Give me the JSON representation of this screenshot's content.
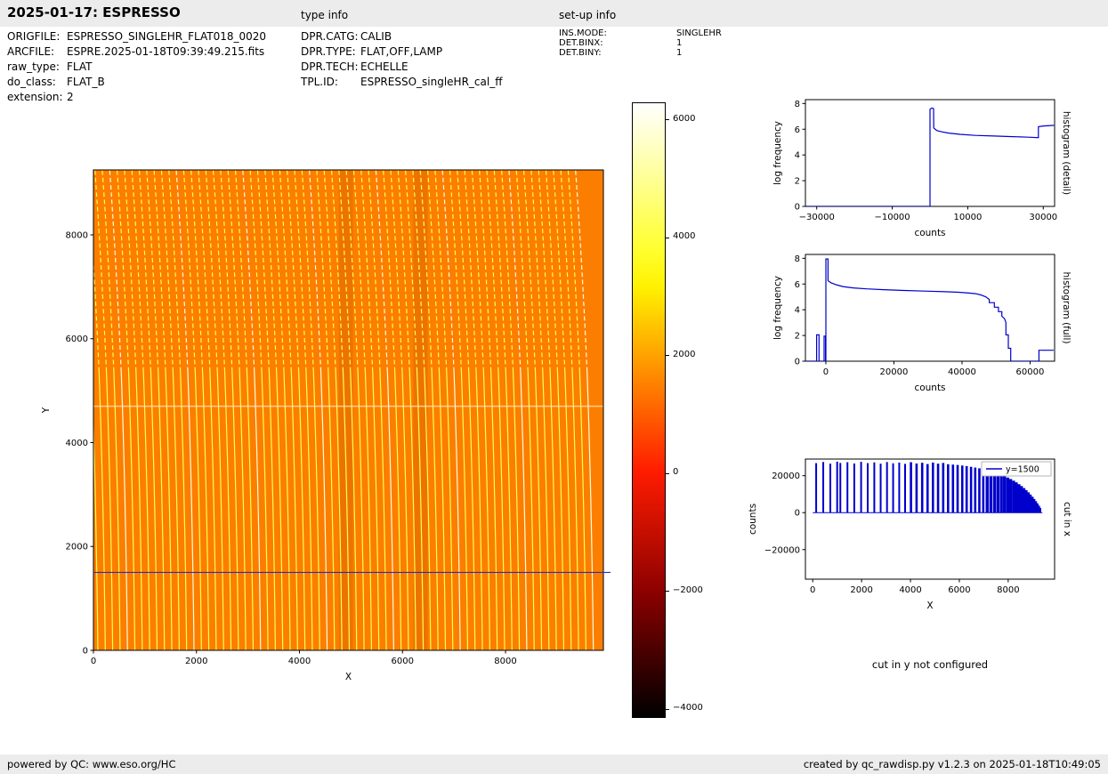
{
  "header": {
    "title": "2025-01-17: ESPRESSO",
    "type_info_label": "type info",
    "setup_info_label": "set-up info"
  },
  "file_info": {
    "rows": [
      {
        "label": "ORIGFILE:",
        "value": "ESPRESSO_SINGLEHR_FLAT018_0020"
      },
      {
        "label": "ARCFILE:",
        "value": "ESPRE.2025-01-18T09:39:49.215.fits"
      },
      {
        "label": "raw_type:",
        "value": "FLAT"
      },
      {
        "label": "do_class:",
        "value": "FLAT_B"
      },
      {
        "label": "extension:",
        "value": "2"
      }
    ]
  },
  "type_info": {
    "rows": [
      {
        "label": "DPR.CATG:",
        "value": "CALIB"
      },
      {
        "label": "DPR.TYPE:",
        "value": "FLAT,OFF,LAMP"
      },
      {
        "label": "DPR.TECH:",
        "value": "ECHELLE"
      },
      {
        "label": "TPL.ID:",
        "value": "ESPRESSO_singleHR_cal_ff"
      }
    ]
  },
  "setup_info": {
    "rows": [
      {
        "label": "INS.MODE:",
        "value": "SINGLEHR"
      },
      {
        "label": "DET.BINX:",
        "value": "1"
      },
      {
        "label": "DET.BINY:",
        "value": "1"
      }
    ]
  },
  "notes": {
    "cut_in_y": "cut in y not configured"
  },
  "footer": {
    "left": "powered by QC: www.eso.org/HC",
    "right": "created by qc_rawdisp.py v1.2.3 on 2025-01-18T10:49:05"
  },
  "chart_data": [
    {
      "id": "raw_image",
      "type": "heatmap",
      "title": "",
      "xlabel": "X",
      "ylabel": "Y",
      "xlim": [
        0,
        9900
      ],
      "ylim": [
        0,
        9250
      ],
      "xticks": [
        0,
        2000,
        4000,
        6000,
        8000
      ],
      "yticks": [
        0,
        2000,
        4000,
        6000,
        8000
      ],
      "background_color": "#fc7e00",
      "order_colors": [
        "#ffff4d",
        "#ffffd8"
      ],
      "n_orders": 68,
      "dark_bands_x": [
        4900,
        6350
      ],
      "light_band_y": 4700,
      "cut_line": {
        "y": 1500,
        "color": "#2e2eb8"
      },
      "colorbar": {
        "vmin": -4120,
        "vmax": 6300,
        "ticks": [
          6000,
          4000,
          2000,
          0,
          -2000,
          -4000
        ],
        "cmap": "hot",
        "gradient_stops": [
          {
            "pos": 0.0,
            "color": "#000000"
          },
          {
            "pos": 0.2,
            "color": "#8a0000"
          },
          {
            "pos": 0.4,
            "color": "#ff1c00"
          },
          {
            "pos": 0.5,
            "color": "#ff6300"
          },
          {
            "pos": 0.6,
            "color": "#ffaa00"
          },
          {
            "pos": 0.7,
            "color": "#fff100"
          },
          {
            "pos": 0.76,
            "color": "#ffff2e"
          },
          {
            "pos": 0.87,
            "color": "#ffff8f"
          },
          {
            "pos": 1.0,
            "color": "#ffffff"
          }
        ]
      }
    },
    {
      "id": "histogram_detail",
      "type": "line",
      "side_label": "histogram (detail)",
      "xlabel": "counts",
      "ylabel": "log frequency",
      "xlim": [
        -33000,
        33000
      ],
      "ylim": [
        0,
        8.3
      ],
      "xticks": [
        -30000,
        -10000,
        10000,
        30000
      ],
      "yticks": [
        0,
        2,
        4,
        6,
        8
      ],
      "line_color": "#0000cc",
      "points": [
        [
          -32800,
          0
        ],
        [
          -700,
          0
        ],
        [
          0,
          0
        ],
        [
          0,
          7.55
        ],
        [
          500,
          7.65
        ],
        [
          950,
          7.6
        ],
        [
          1000,
          6.1
        ],
        [
          1800,
          5.9
        ],
        [
          3000,
          5.8
        ],
        [
          5000,
          5.7
        ],
        [
          8000,
          5.6
        ],
        [
          12000,
          5.52
        ],
        [
          17000,
          5.47
        ],
        [
          22000,
          5.42
        ],
        [
          26000,
          5.38
        ],
        [
          28700,
          5.35
        ],
        [
          28700,
          6.2
        ],
        [
          30000,
          6.25
        ],
        [
          32800,
          6.3
        ]
      ]
    },
    {
      "id": "histogram_full",
      "type": "line",
      "side_label": "histogram (full)",
      "xlabel": "counts",
      "ylabel": "log frequency",
      "xlim": [
        -6000,
        67200
      ],
      "ylim": [
        0,
        8.3
      ],
      "xticks": [
        0,
        20000,
        40000,
        60000
      ],
      "yticks": [
        0,
        2,
        4,
        6,
        8
      ],
      "line_color": "#0000cc",
      "points": [
        [
          -5800,
          0
        ],
        [
          -2700,
          0
        ],
        [
          -2700,
          2.05
        ],
        [
          -2000,
          2.05
        ],
        [
          -2000,
          0
        ],
        [
          -500,
          0
        ],
        [
          -500,
          1.95
        ],
        [
          -100,
          1.95
        ],
        [
          -100,
          0
        ],
        [
          0,
          0
        ],
        [
          0,
          7.95
        ],
        [
          650,
          7.95
        ],
        [
          650,
          6.25
        ],
        [
          1500,
          6.1
        ],
        [
          3000,
          5.95
        ],
        [
          5000,
          5.8
        ],
        [
          8000,
          5.7
        ],
        [
          12000,
          5.62
        ],
        [
          17000,
          5.56
        ],
        [
          23000,
          5.5
        ],
        [
          29000,
          5.45
        ],
        [
          35000,
          5.4
        ],
        [
          39000,
          5.36
        ],
        [
          42000,
          5.3
        ],
        [
          44000,
          5.25
        ],
        [
          45500,
          5.15
        ],
        [
          47000,
          5.0
        ],
        [
          48000,
          4.8
        ],
        [
          48000,
          4.55
        ],
        [
          49500,
          4.55
        ],
        [
          49500,
          4.2
        ],
        [
          50700,
          4.2
        ],
        [
          50700,
          3.85
        ],
        [
          51700,
          3.85
        ],
        [
          51700,
          3.5
        ],
        [
          52500,
          3.3
        ],
        [
          52900,
          3.0
        ],
        [
          52900,
          2.05
        ],
        [
          53600,
          2.05
        ],
        [
          53600,
          1.0
        ],
        [
          54300,
          1.0
        ],
        [
          54300,
          0
        ],
        [
          62600,
          0
        ],
        [
          62600,
          0.85
        ],
        [
          66900,
          0.85
        ]
      ]
    },
    {
      "id": "cut_in_x",
      "type": "bar",
      "side_label": "cut in x",
      "xlabel": "X",
      "ylabel": "counts",
      "legend": "y=1500",
      "xlim": [
        -300,
        9900
      ],
      "ylim": [
        -36000,
        29000
      ],
      "xticks": [
        0,
        2000,
        4000,
        6000,
        8000
      ],
      "yticks": [
        -20000,
        0,
        20000
      ],
      "line_color": "#0000cc",
      "baseline_x": [
        0,
        9400
      ],
      "bars": [
        [
          140,
          26800
        ],
        [
          430,
          27400
        ],
        [
          720,
          26500
        ],
        [
          1000,
          27600
        ],
        [
          1130,
          26900
        ],
        [
          1420,
          27300
        ],
        [
          1700,
          26600
        ],
        [
          1980,
          27500
        ],
        [
          2250,
          26800
        ],
        [
          2520,
          27200
        ],
        [
          2780,
          26500
        ],
        [
          3040,
          27400
        ],
        [
          3290,
          26700
        ],
        [
          3540,
          27100
        ],
        [
          3780,
          26400
        ],
        [
          4020,
          27300
        ],
        [
          4250,
          26600
        ],
        [
          4480,
          27000
        ],
        [
          4700,
          26300
        ],
        [
          4920,
          27100
        ],
        [
          5130,
          26500
        ],
        [
          5340,
          26900
        ],
        [
          5540,
          26200
        ],
        [
          5740,
          26000
        ],
        [
          5930,
          25800
        ],
        [
          6120,
          25500
        ],
        [
          6300,
          25200
        ],
        [
          6480,
          24800
        ],
        [
          6650,
          24400
        ],
        [
          6820,
          24000
        ],
        [
          6980,
          23500
        ],
        [
          7140,
          23000
        ],
        [
          7290,
          22400
        ],
        [
          7440,
          21800
        ],
        [
          7580,
          21200
        ],
        [
          7720,
          20500
        ],
        [
          7850,
          19800
        ],
        [
          7980,
          19000
        ],
        [
          8100,
          18200
        ],
        [
          8220,
          17300
        ],
        [
          8330,
          16400
        ],
        [
          8440,
          15400
        ],
        [
          8540,
          14400
        ],
        [
          8640,
          13300
        ],
        [
          8730,
          12200
        ],
        [
          8820,
          11000
        ],
        [
          8900,
          9800
        ],
        [
          8980,
          8600
        ],
        [
          9050,
          7400
        ],
        [
          9120,
          6200
        ],
        [
          9180,
          5000
        ],
        [
          9240,
          3800
        ],
        [
          9290,
          2600
        ]
      ]
    }
  ]
}
